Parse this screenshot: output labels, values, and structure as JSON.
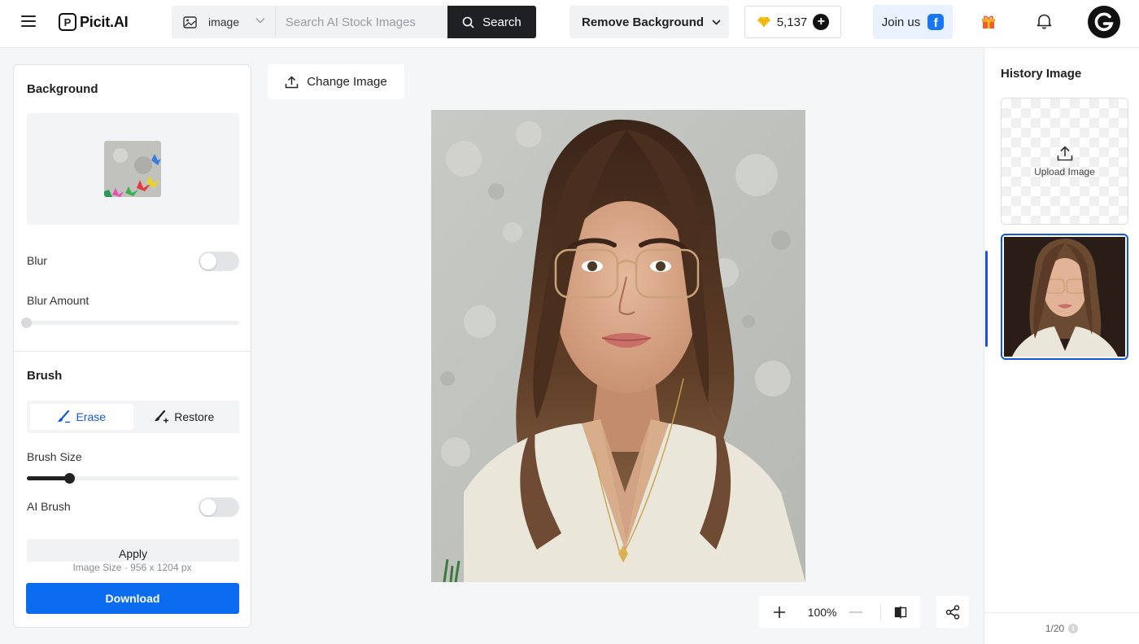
{
  "header": {
    "brand": "Picit.AI",
    "brand_mark": "P",
    "search_type": "image",
    "search_placeholder": "Search AI Stock Images",
    "search_button": "Search",
    "tool_select": "Remove Background",
    "credits": "5,137",
    "join_us": "Join us",
    "avatar_letter": "G"
  },
  "left_panel": {
    "background_title": "Background",
    "blur_label": "Blur",
    "blur_enabled": false,
    "blur_amount_label": "Blur Amount",
    "blur_amount_value": 0,
    "brush_title": "Brush",
    "brush_modes": [
      "Erase",
      "Restore"
    ],
    "active_mode": "Erase",
    "brush_size_label": "Brush Size",
    "brush_size_fraction": 0.2,
    "ai_brush_label": "AI Brush",
    "ai_brush_enabled": false,
    "apply_button": "Apply",
    "image_size_text": "Image Size · 956 x 1204 px",
    "download_button": "Download"
  },
  "canvas": {
    "change_image_button": "Change Image",
    "zoom": "100%"
  },
  "right_panel": {
    "title": "History Image",
    "upload_label": "Upload Image",
    "page_counter": "1/20"
  },
  "colors": {
    "accent_blue": "#0b6cf0",
    "selection_blue": "#1557d6",
    "dark": "#1e2024"
  },
  "icons": [
    "menu-icon",
    "image-icon",
    "chevron-down-icon",
    "search-icon",
    "diamond-icon",
    "plus-icon",
    "facebook-icon",
    "gift-icon",
    "bell-icon",
    "upload-icon",
    "brush-icon",
    "restore-brush-icon",
    "zoom-in-icon",
    "zoom-out-icon",
    "compare-icon",
    "share-icon",
    "info-icon"
  ]
}
